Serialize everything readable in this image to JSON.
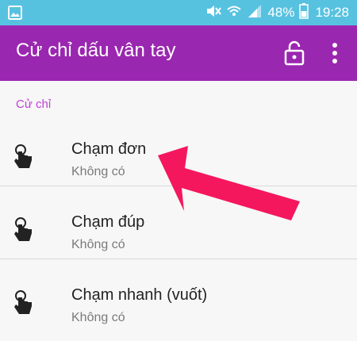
{
  "status_bar": {
    "battery": "48%",
    "time": "19:28",
    "icons": [
      "gallery-notification-icon",
      "mute-icon",
      "wifi-calling-icon",
      "signal-icon",
      "battery-icon"
    ]
  },
  "app_bar": {
    "title": "Cử chỉ dấu vân tay",
    "actions": [
      "lock-icon",
      "more-vert-icon"
    ]
  },
  "section": {
    "header": "Cử chỉ",
    "items": [
      {
        "title": "Chạm đơn",
        "subtitle": "Không có",
        "icon": "tap-gesture-icon"
      },
      {
        "title": "Chạm đúp",
        "subtitle": "Không có",
        "icon": "tap-gesture-icon"
      },
      {
        "title": "Chạm nhanh (vuốt)",
        "subtitle": "Không có",
        "icon": "tap-gesture-icon"
      }
    ]
  },
  "colors": {
    "status_bar": "#57c2e0",
    "app_bar": "#9a27b0",
    "section_header": "#c040d8",
    "annotation_arrow": "#f5175d"
  }
}
